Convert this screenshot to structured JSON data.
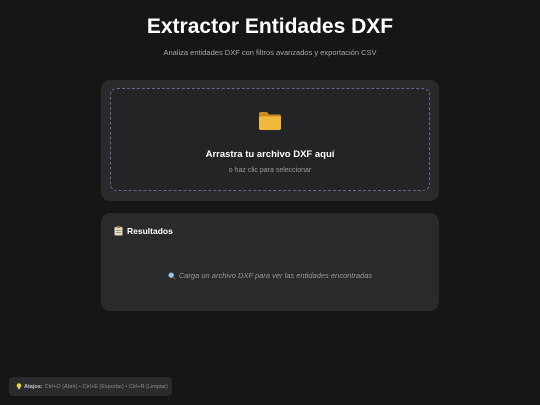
{
  "header": {
    "title": "Extractor Entidades DXF",
    "subtitle": "Analiza entidades DXF con filtros avanzados y exportación CSV"
  },
  "upload": {
    "icon": "folder-icon",
    "title": "Arrastra tu archivo DXF aquí",
    "hint": "o haz clic para seleccionar"
  },
  "results": {
    "icon": "clipboard-icon",
    "title": "Resultados",
    "empty_icon": "search-icon",
    "empty_message": "Carga un archivo DXF para ver las entidades encontradas"
  },
  "shortcuts": {
    "icon": "lightbulb-icon",
    "label": "Atajos:",
    "text": "Ctrl+O (Abrir) • Ctrl+E (Exportar) • Ctrl+R (Limpiar)"
  },
  "colors": {
    "background": "#161616",
    "card": "#2a2a2c",
    "dropzone_border": "#6f6294",
    "folder": "#e9b43a"
  }
}
